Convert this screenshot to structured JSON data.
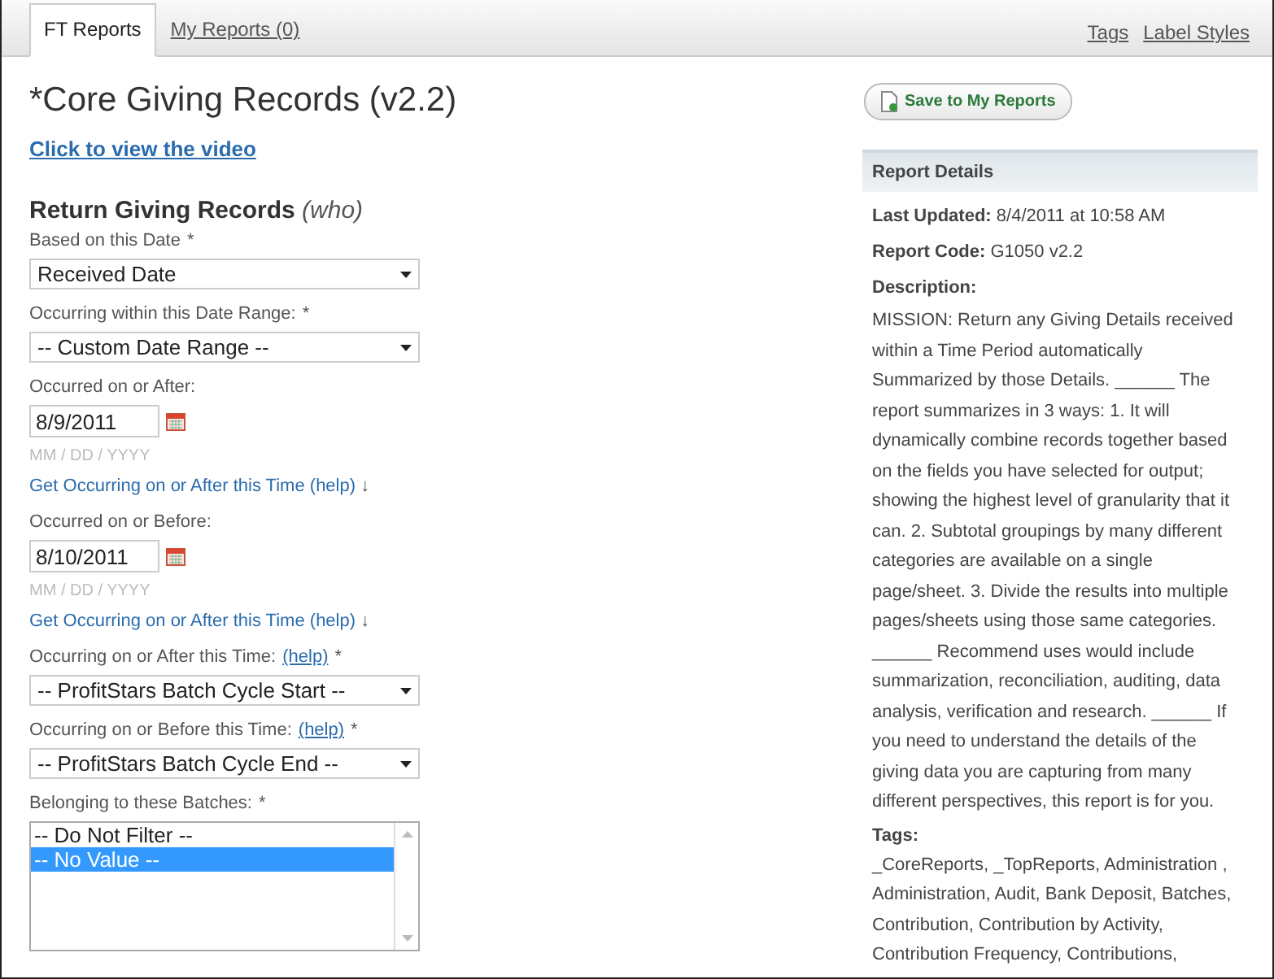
{
  "tabs": [
    {
      "label": "FT Reports",
      "selected": true
    },
    {
      "label": "My Reports (0)",
      "selected": false
    }
  ],
  "top_links": [
    "Tags",
    "Label Styles"
  ],
  "title": "*Core Giving Records (v2.2)",
  "video_link": "Click to view the video",
  "section": {
    "title": "Return Giving Records",
    "note": "(who)"
  },
  "fields": [
    {
      "kind": "select",
      "label": "Based on this Date",
      "mark": "*",
      "value": "Received Date"
    },
    {
      "kind": "select",
      "label": "Occurring within this Date Range:",
      "mark": "*",
      "value": "-- Custom Date Range --"
    },
    {
      "kind": "date",
      "label": "Occurred on or After:",
      "value": "8/9/2011",
      "hint": "MM / DD / YYYY",
      "link": "Get Occurring on or After this Time",
      "help": "(help)",
      "arrow": "↓"
    },
    {
      "kind": "date",
      "label": "Occurred on or Before:",
      "value": "8/10/2011",
      "hint": "MM / DD / YYYY",
      "link": "Get Occurring on or After this Time",
      "help": "(help)",
      "arrow": "↓"
    },
    {
      "kind": "select",
      "label": "Occurring on or After this Time:",
      "help": "(help)",
      "mark": "*",
      "value": "-- ProfitStars Batch Cycle Start --"
    },
    {
      "kind": "select",
      "label": "Occurring on or Before this Time:",
      "help": "(help)",
      "mark": "*",
      "value": "-- ProfitStars Batch Cycle End --"
    },
    {
      "kind": "listbox",
      "label": "Belonging to these Batches:",
      "mark": "*",
      "options": [
        {
          "label": "-- Do Not Filter --",
          "selected": false
        },
        {
          "label": "-- No Value --",
          "selected": true
        }
      ]
    }
  ],
  "save_button": "Save to My Reports",
  "details": {
    "heading": "Report Details",
    "items": [
      {
        "label": "Last Updated:",
        "value": "8/4/2011 at 10:58 AM"
      },
      {
        "label": "Report Code:",
        "value": "G1050 v2.2"
      }
    ],
    "description_label": "Description:",
    "description": "MISSION: Return any Giving Details received within a Time Period automatically Summarized by those Details. ______  The report summarizes in 3 ways: 1. It will dynamically combine records together based on the fields you have selected for output; showing the highest level of granularity that it can. 2. Subtotal groupings by many different categories are available on a single page/sheet. 3. Divide the results into multiple pages/sheets using those same categories. ______ Recommend uses would include summarization, reconciliation, auditing, data analysis, verification and research.  ______ If you need to understand the details of the giving data you are capturing from many different perspectives, this report is for you.",
    "tags_label": "Tags:",
    "tags": "_CoreReports, _TopReports, Administration , Administration, Audit, Bank Deposit, Batches, Contribution, Contribution by Activity, Contribution Frequency, Contributions,"
  }
}
